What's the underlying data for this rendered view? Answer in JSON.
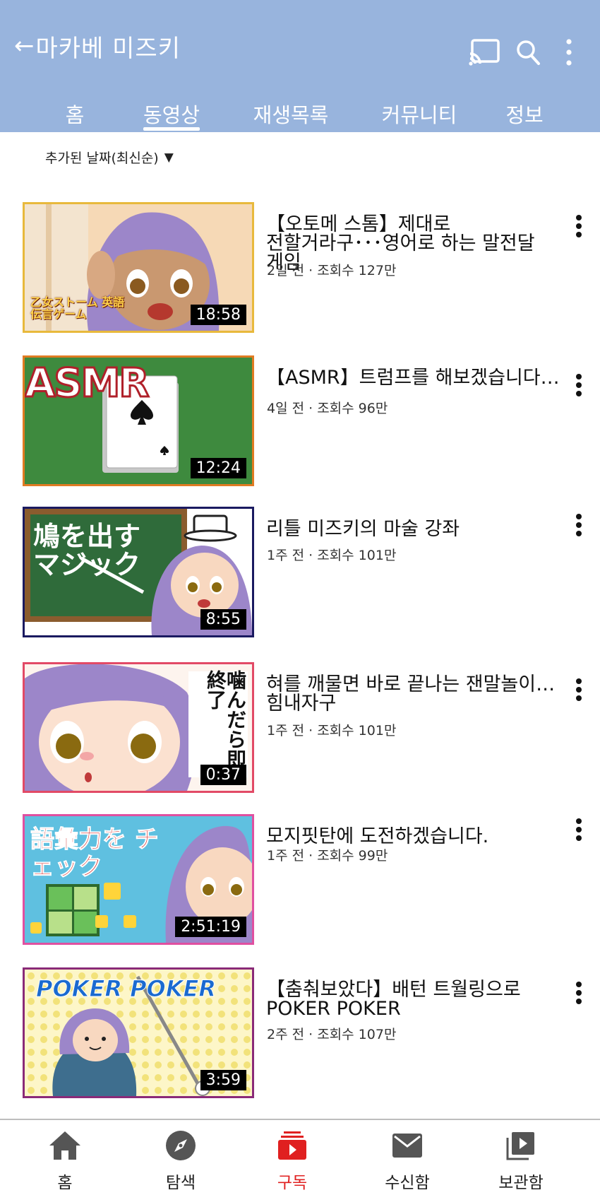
{
  "header": {
    "back_arrow": "←",
    "title": "마카베 미즈키",
    "bg_color": "#98b4dd"
  },
  "tabs": [
    {
      "label": "홈",
      "active": false
    },
    {
      "label": "동영상",
      "active": true
    },
    {
      "label": "재생목록",
      "active": false
    },
    {
      "label": "커뮤니티",
      "active": false
    },
    {
      "label": "정보",
      "active": false
    }
  ],
  "sort": {
    "label": "추가된 날짜(최신순)",
    "caret": "▼"
  },
  "videos": [
    {
      "title": "【오토메 스톰】제대로 전할거라구･･･영어로 하는 말전달 게임",
      "meta": "2일 전 · 조회수 127만",
      "duration": "18:58",
      "thumb_text": "乙女ストーム 英語伝言ゲーム",
      "border_color": "#e8b93c"
    },
    {
      "title": "【ASMR】트럼프를 해보겠습니다…",
      "meta": "4일 전 · 조회수 96만",
      "duration": "12:24",
      "thumb_text": "ASMR",
      "border_color": "#e07b22"
    },
    {
      "title": "리틀 미즈키의 마술 강좌",
      "meta": "1주 전 · 조회수 101만",
      "duration": "8:55",
      "thumb_text": "鳩を出す マジック",
      "border_color": "#1a1a60"
    },
    {
      "title": "혀를 깨물면 바로 끝나는 잰말놀이…힘내자구",
      "meta": "1주 전 · 조회수 101만",
      "duration": "0:37",
      "thumb_text": "噛んだら即終了",
      "border_color": "#e24a66"
    },
    {
      "title": "모지핏탄에 도전하겠습니다.",
      "meta": "1주 전 · 조회수 99만",
      "duration": "2:51:19",
      "thumb_text": "語彙力を チェック",
      "border_color": "#e050a0"
    },
    {
      "title": "【춤춰보았다】배턴 트월링으로 POKER POKER",
      "meta": "2주 전 · 조회수 107만",
      "duration": "3:59",
      "thumb_text": "POKER POKER",
      "border_color": "#8a2a78"
    }
  ],
  "bottom_nav": [
    {
      "label": "홈",
      "icon": "home-icon",
      "active": false
    },
    {
      "label": "탐색",
      "icon": "compass-icon",
      "active": false
    },
    {
      "label": "구독",
      "icon": "subscriptions-icon",
      "active": true
    },
    {
      "label": "수신함",
      "icon": "inbox-icon",
      "active": false
    },
    {
      "label": "보관함",
      "icon": "library-icon",
      "active": false
    }
  ],
  "colors": {
    "active_red": "#e02020",
    "text": "#111111"
  }
}
